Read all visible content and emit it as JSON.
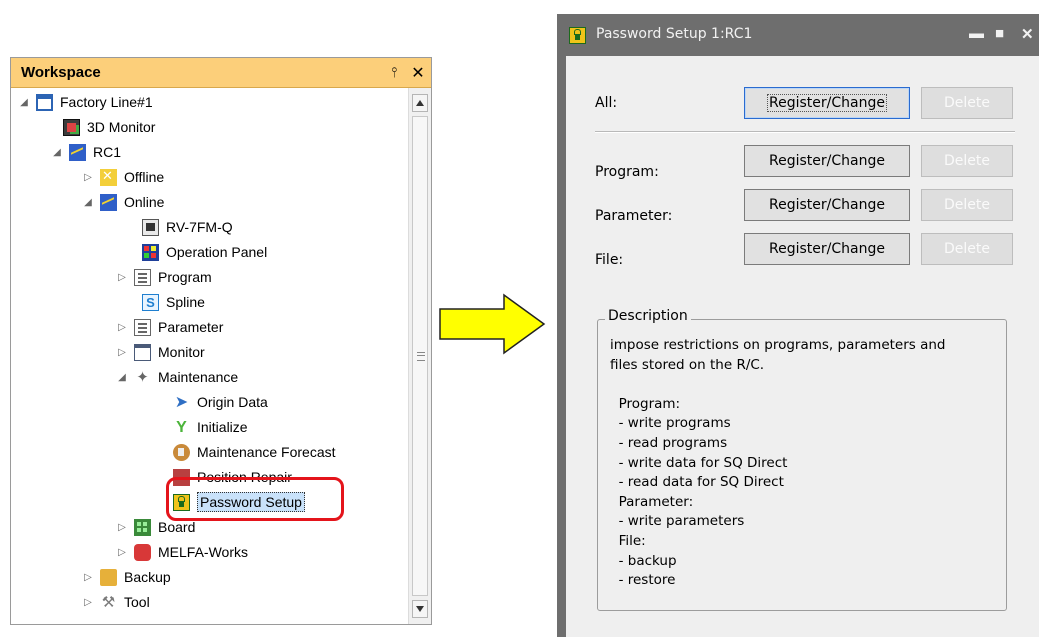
{
  "workspace": {
    "title": "Workspace",
    "pin_glyph": "&#x1D1A;",
    "close_glyph": "✕",
    "tree": [
      {
        "label": "Factory Line#1",
        "icon": "factory-line-icon",
        "expander": "⊿"
      },
      {
        "label": "3D Monitor",
        "icon": "3d-monitor-icon",
        "expander": ""
      },
      {
        "label": "RC1",
        "icon": "robot-controller-icon",
        "expander": "⊿"
      },
      {
        "label": "Offline",
        "icon": "offline-icon",
        "expander": "▷"
      },
      {
        "label": "Online",
        "icon": "online-icon",
        "expander": "⊿"
      },
      {
        "label": "RV-7FM-Q",
        "icon": "robot-model-icon",
        "expander": ""
      },
      {
        "label": "Operation Panel",
        "icon": "operation-panel-icon",
        "expander": ""
      },
      {
        "label": "Program",
        "icon": "program-icon",
        "expander": "▷"
      },
      {
        "label": "Spline",
        "icon": "spline-icon",
        "expander": ""
      },
      {
        "label": "Parameter",
        "icon": "parameter-icon",
        "expander": "▷"
      },
      {
        "label": "Monitor",
        "icon": "monitor-icon",
        "expander": "▷"
      },
      {
        "label": "Maintenance",
        "icon": "maintenance-icon",
        "expander": "⊿"
      },
      {
        "label": "Origin Data",
        "icon": "origin-data-icon",
        "expander": ""
      },
      {
        "label": "Initialize",
        "icon": "initialize-icon",
        "expander": ""
      },
      {
        "label": "Maintenance Forecast",
        "icon": "maintenance-forecast-icon",
        "expander": ""
      },
      {
        "label": "Position Repair",
        "icon": "position-repair-icon",
        "expander": ""
      },
      {
        "label": "Password Setup",
        "icon": "password-setup-icon",
        "expander": "",
        "selected": true
      },
      {
        "label": "Board",
        "icon": "board-icon",
        "expander": "▷"
      },
      {
        "label": "MELFA-Works",
        "icon": "melfa-works-icon",
        "expander": "▷"
      },
      {
        "label": "Backup",
        "icon": "backup-icon",
        "expander": "▷"
      },
      {
        "label": "Tool",
        "icon": "tool-icon",
        "expander": "▷"
      }
    ]
  },
  "dialog": {
    "title": "Password Setup 1:RC1",
    "rows": [
      {
        "label": "All:",
        "register": "Register/Change",
        "delete": "Delete"
      },
      {
        "label": "Program:",
        "register": "Register/Change",
        "delete": "Delete"
      },
      {
        "label": "Parameter:",
        "register": "Register/Change",
        "delete": "Delete"
      },
      {
        "label": "File:",
        "register": "Register/Change",
        "delete": "Delete"
      }
    ],
    "description_title": "Description",
    "description_text": "impose restrictions on programs, parameters and\nfiles stored on the R/C.\n\n  Program:\n  - write programs\n  - read programs\n  - write data for SQ Direct\n  - read data for SQ Direct\n  Parameter:\n  - write parameters\n  File:\n  - backup\n  - restore"
  },
  "colors": {
    "workspace_header": "#fccf7a",
    "highlight_box": "#e4141b",
    "arrow_fill": "#ffff00",
    "dialog_frame": "#6e6e6e",
    "dialog_client": "#efefef"
  }
}
